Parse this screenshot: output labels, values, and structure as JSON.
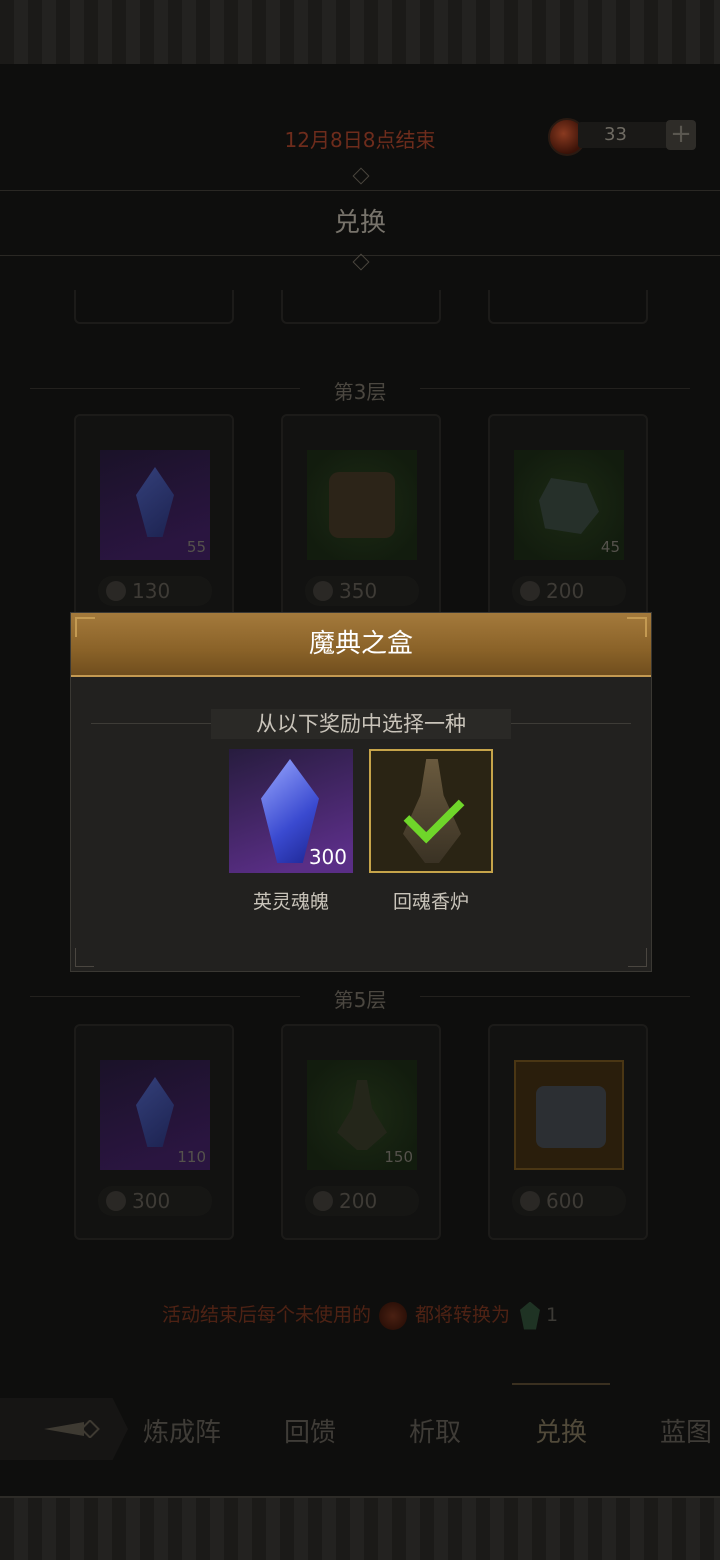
{
  "header": {
    "end_notice": "12月8日8点结束",
    "currency_amount": "33",
    "add_symbol": "+",
    "section_title": "兑换"
  },
  "layers": [
    {
      "label": "第3层",
      "items": [
        {
          "icon": "blue-crystal-icon",
          "qty": "55",
          "price": "130"
        },
        {
          "icon": "dark-box-icon",
          "qty": "",
          "price": "350"
        },
        {
          "icon": "green-ore-icon",
          "qty": "45",
          "price": "200"
        }
      ]
    },
    {
      "label": "第5层",
      "items": [
        {
          "icon": "blue-crystal-icon",
          "qty": "110",
          "price": "300"
        },
        {
          "icon": "censer-icon",
          "qty": "150",
          "price": "200"
        },
        {
          "icon": "armor-chest-icon",
          "qty": "",
          "price": "600"
        }
      ]
    }
  ],
  "footer_note": {
    "text_before": "活动结束后每个未使用的",
    "text_middle": "都将转换为",
    "amount": "1"
  },
  "tabs": [
    {
      "label": "炼成阵",
      "active": false
    },
    {
      "label": "回馈",
      "active": false
    },
    {
      "label": "析取",
      "active": false
    },
    {
      "label": "兑换",
      "active": true
    },
    {
      "label": "蓝图",
      "active": false
    }
  ],
  "popup": {
    "title": "魔典之盒",
    "subtitle": "从以下奖励中选择一种",
    "rewards": [
      {
        "name": "英灵魂魄",
        "qty": "300",
        "icon": "soul-crystal-icon",
        "selected": false
      },
      {
        "name": "回魂香炉",
        "qty": "",
        "icon": "incense-burner-icon",
        "selected": true
      }
    ]
  },
  "colors": {
    "popup_header": "#a47a3c",
    "check": "#6fd62a",
    "end_notice": "#6e2c1c"
  }
}
